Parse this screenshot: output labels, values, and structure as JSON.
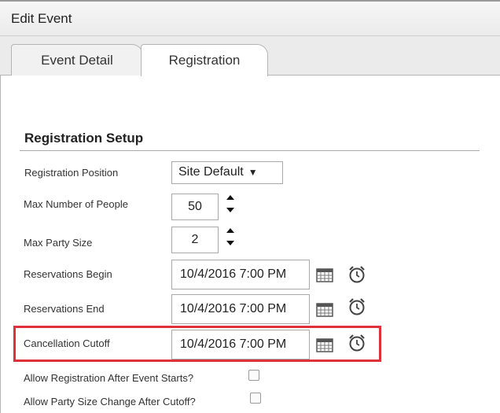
{
  "window": {
    "title": "Edit Event"
  },
  "tabs": [
    {
      "label": "Event Detail"
    },
    {
      "label": "Registration"
    }
  ],
  "section": {
    "title": "Registration Setup"
  },
  "fields": {
    "registration_position": {
      "label": "Registration Position",
      "value": "Site Default",
      "arrow": "▼"
    },
    "max_people": {
      "label": "Max Number of People",
      "value": "50"
    },
    "max_party": {
      "label": "Max Party Size",
      "value": "2"
    },
    "reservations_begin": {
      "label": "Reservations Begin",
      "value": "10/4/2016 7:00 PM"
    },
    "reservations_end": {
      "label": "Reservations End",
      "value": "10/4/2016 7:00 PM"
    },
    "cancellation_cutoff": {
      "label": "Cancellation Cutoff",
      "value": "10/4/2016 7:00 PM"
    },
    "allow_after_start": {
      "label": "Allow Registration After Event Starts?",
      "checked": false
    },
    "allow_party_change": {
      "label": "Allow Party Size Change After Cutoff?",
      "checked": false
    }
  },
  "colors": {
    "highlight": "#e0303a",
    "border": "#a9a9a9"
  }
}
